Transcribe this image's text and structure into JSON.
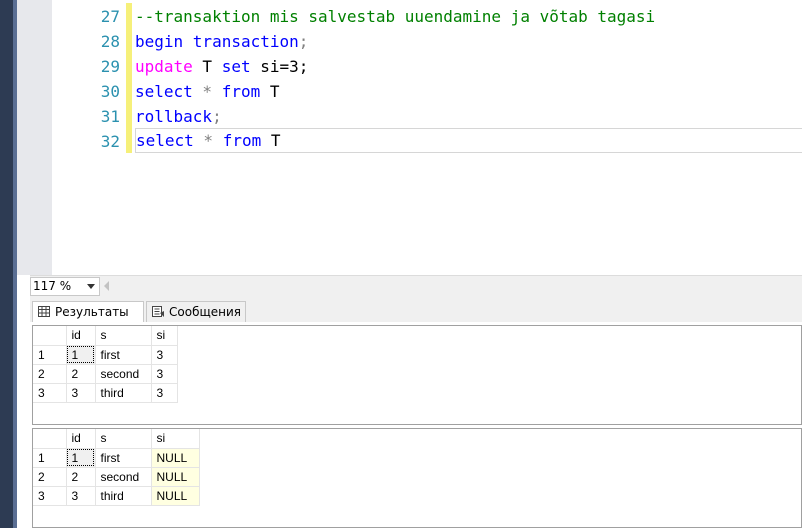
{
  "editor": {
    "lines": [
      {
        "num": "27",
        "text": "--transaktion mis salvestab uuendamine ja võtab tagasi"
      },
      {
        "num": "28",
        "kw": "begin transaction",
        "rest": ";"
      },
      {
        "num": "29",
        "kw": "update",
        "rest": " T ",
        "kw2": "set",
        "rest2": " si=3;"
      },
      {
        "num": "30",
        "kw": "select",
        "op": " * ",
        "kw2": "from",
        "rest": " T"
      },
      {
        "num": "31",
        "kw": "rollback",
        "rest": ";"
      },
      {
        "num": "32",
        "kw": "select",
        "op": " * ",
        "kw2": "from",
        "rest": " T"
      }
    ]
  },
  "zoom": {
    "value": "117 %"
  },
  "tabs": {
    "results": "Результаты",
    "messages": "Сообщения"
  },
  "grid1": {
    "headers": [
      "id",
      "s",
      "si"
    ],
    "rows": [
      {
        "rn": "1",
        "id": "1",
        "s": "first",
        "si": "3"
      },
      {
        "rn": "2",
        "id": "2",
        "s": "second",
        "si": "3"
      },
      {
        "rn": "3",
        "id": "3",
        "s": "third",
        "si": "3"
      }
    ]
  },
  "grid2": {
    "headers": [
      "id",
      "s",
      "si"
    ],
    "rows": [
      {
        "rn": "1",
        "id": "1",
        "s": "first",
        "si": "NULL"
      },
      {
        "rn": "2",
        "id": "2",
        "s": "second",
        "si": "NULL"
      },
      {
        "rn": "3",
        "id": "3",
        "s": "third",
        "si": "NULL"
      }
    ]
  },
  "colors": {
    "comment": "#008000",
    "keyword": "#0000ff",
    "keyword_magenta": "#ff00ff",
    "line_number": "#2b91af",
    "change_bar": "#f6f07a",
    "null_cell": "#ffffe1"
  },
  "icons": {
    "results": "grid-icon",
    "messages": "message-icon"
  }
}
